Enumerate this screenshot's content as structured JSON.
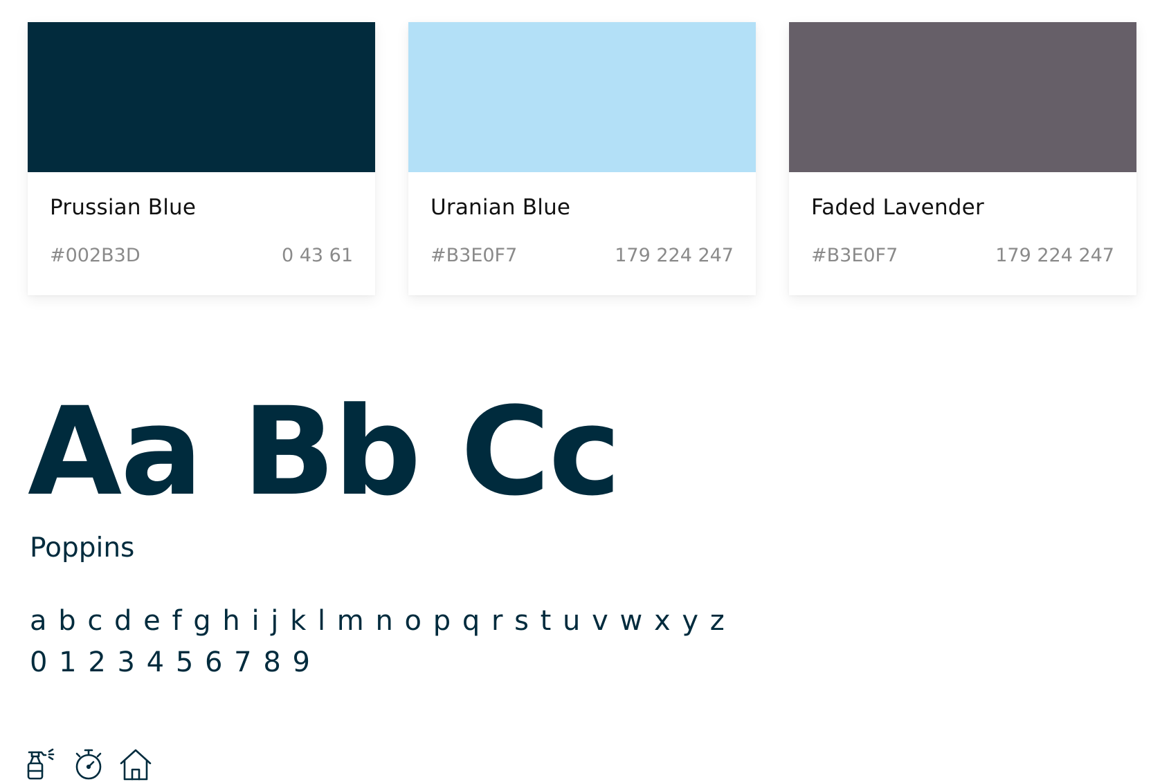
{
  "colors": [
    {
      "name": "Prussian Blue",
      "hex": "#002B3D",
      "rgb": "0 43 61",
      "swatch": "#022B3D"
    },
    {
      "name": "Uranian Blue",
      "hex": "#B3E0F7",
      "rgb": "179 224 247",
      "swatch": "#B3E0F7"
    },
    {
      "name": "Faded Lavender",
      "hex": "#B3E0F7",
      "rgb": "179 224 247",
      "swatch": "#665F68"
    }
  ],
  "typography": {
    "specimen": "Aa Bb Cc",
    "font_name": "Poppins",
    "alphabet": "a b c d e f g h i j k l m n o p q r s t u v w x y z",
    "digits": "0 1 2 3 4 5 6 7 8 9"
  },
  "icons": [
    "spray-bottle-icon",
    "stopwatch-icon",
    "home-icon"
  ],
  "theme": {
    "primary": "#002B3D",
    "muted_text": "#8A8A8A"
  }
}
